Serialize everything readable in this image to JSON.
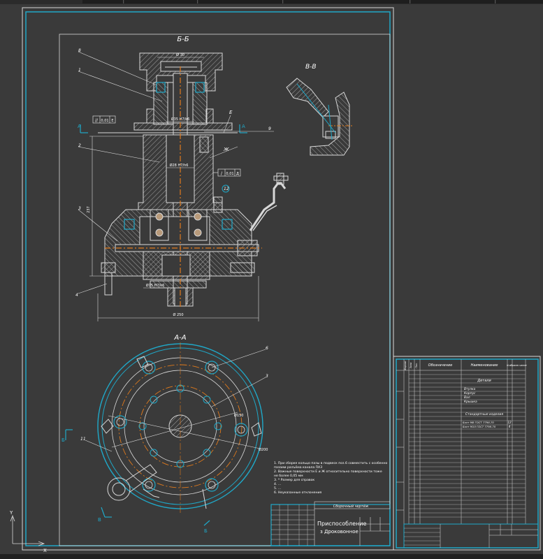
{
  "views": {
    "section_bb": "Б-Б",
    "view_vv": "В-В",
    "section_aa": "А-А"
  },
  "callouts": {
    "c1": "1",
    "c2": "2",
    "c3": "3",
    "c4": "4",
    "c6": "6",
    "c8": "8",
    "c9": "9",
    "c11": "11",
    "c12": "12"
  },
  "markers": {
    "A_left": "A",
    "A_right": "A",
    "B_mark": "Б",
    "V_mark": "В",
    "E_mark": "Е",
    "Zh_mark": "Ж"
  },
  "dimensions": {
    "top_width": "Ø 30",
    "bore": "Ø35 H7/k6",
    "mid_fit": "Ø28 H7/h6",
    "low_fit": "Ø75 H7/k6",
    "height": "237",
    "base_width": "Ø 250",
    "circle_small": "Ø150",
    "circle_large": "Ø200"
  },
  "tolerance_frames": {
    "t1_sym": "//",
    "t1_val": "0,01",
    "t1_ref": "Е",
    "t2_sym": "/",
    "t2_val": "0,01",
    "t2_ref": "Д"
  },
  "notes": [
    "1. При сборке кольцо пазы в подвеск поз.6 совместить с особенно",
    "    пазами разъёма канала ПАЗ",
    "2. Важные поверхности Е и Ж относительно поверхности тоже",
    "    не более 0,05 мм",
    "3. * Размер для справок",
    "4. ...",
    "5. ...",
    "6. Неуказанные отклонения"
  ],
  "title_block": {
    "name_line1": "Приспособление",
    "name_line2": "з Дроковонное",
    "top_row": "Сборочный чертёж"
  },
  "spec_table": {
    "header": {
      "format": "Формат",
      "zone": "Зона",
      "pos": "Поз.",
      "designation": "Обозначение",
      "name": "Наименование",
      "qty": "Кол.",
      "note": "Приме-чание"
    },
    "section_details": "Детали",
    "details": [
      "Втулка",
      "Корпус",
      "Вал",
      "Крышка"
    ],
    "section_standard": "Стандартные изделия",
    "standard": [
      "Болт М8 ГОСТ 7798-70",
      "Болт М10 ГОСТ 7798-70"
    ],
    "standard_qty": [
      "12",
      "4"
    ]
  },
  "colors": {
    "frame": "#1fa8c8",
    "line": "#d8d8d8",
    "hatch": "#c8c8c8",
    "center": "#e07a1c",
    "white": "#ffffff"
  }
}
